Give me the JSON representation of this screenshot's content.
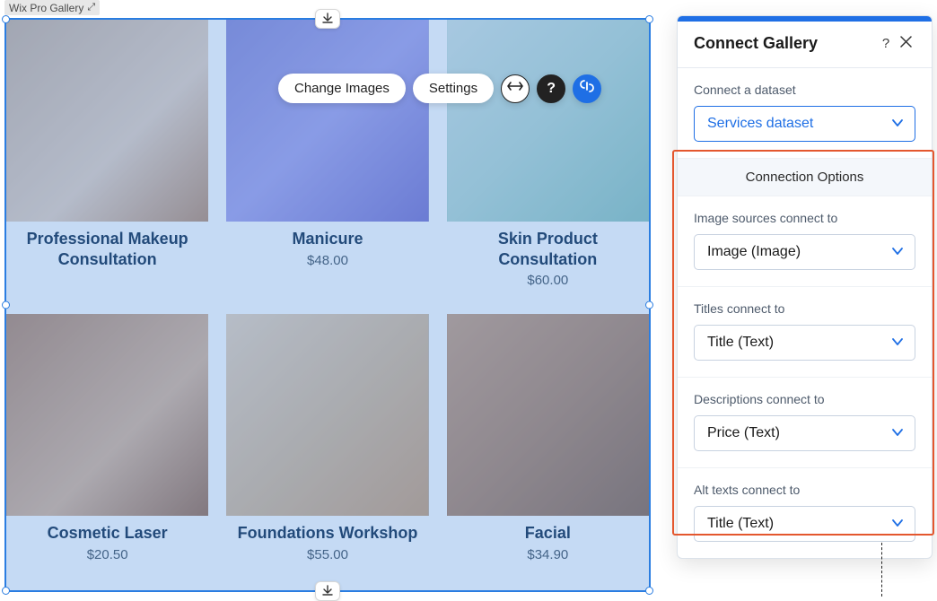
{
  "element_tag": {
    "label": "Wix Pro Gallery"
  },
  "toolbar": {
    "change_images_label": "Change Images",
    "settings_label": "Settings"
  },
  "gallery": {
    "items": [
      {
        "title": "Professional Makeup Consultation",
        "price": ""
      },
      {
        "title": "Manicure",
        "price": "$48.00"
      },
      {
        "title": "Skin Product Consultation",
        "price": "$60.00"
      },
      {
        "title": "Cosmetic Laser",
        "price": "$20.50"
      },
      {
        "title": "Foundations Workshop",
        "price": "$55.00"
      },
      {
        "title": "Facial",
        "price": "$34.90"
      }
    ]
  },
  "panel": {
    "title": "Connect Gallery",
    "dataset_label": "Connect a dataset",
    "dataset_value": "Services dataset",
    "options_header": "Connection Options",
    "fields": {
      "image_sources": {
        "label": "Image sources connect to",
        "value": "Image (Image)"
      },
      "titles": {
        "label": "Titles connect to",
        "value": "Title (Text)"
      },
      "descriptions": {
        "label": "Descriptions connect to",
        "value": "Price (Text)"
      },
      "alt_texts": {
        "label": "Alt texts connect to",
        "value": "Title (Text)"
      }
    }
  }
}
